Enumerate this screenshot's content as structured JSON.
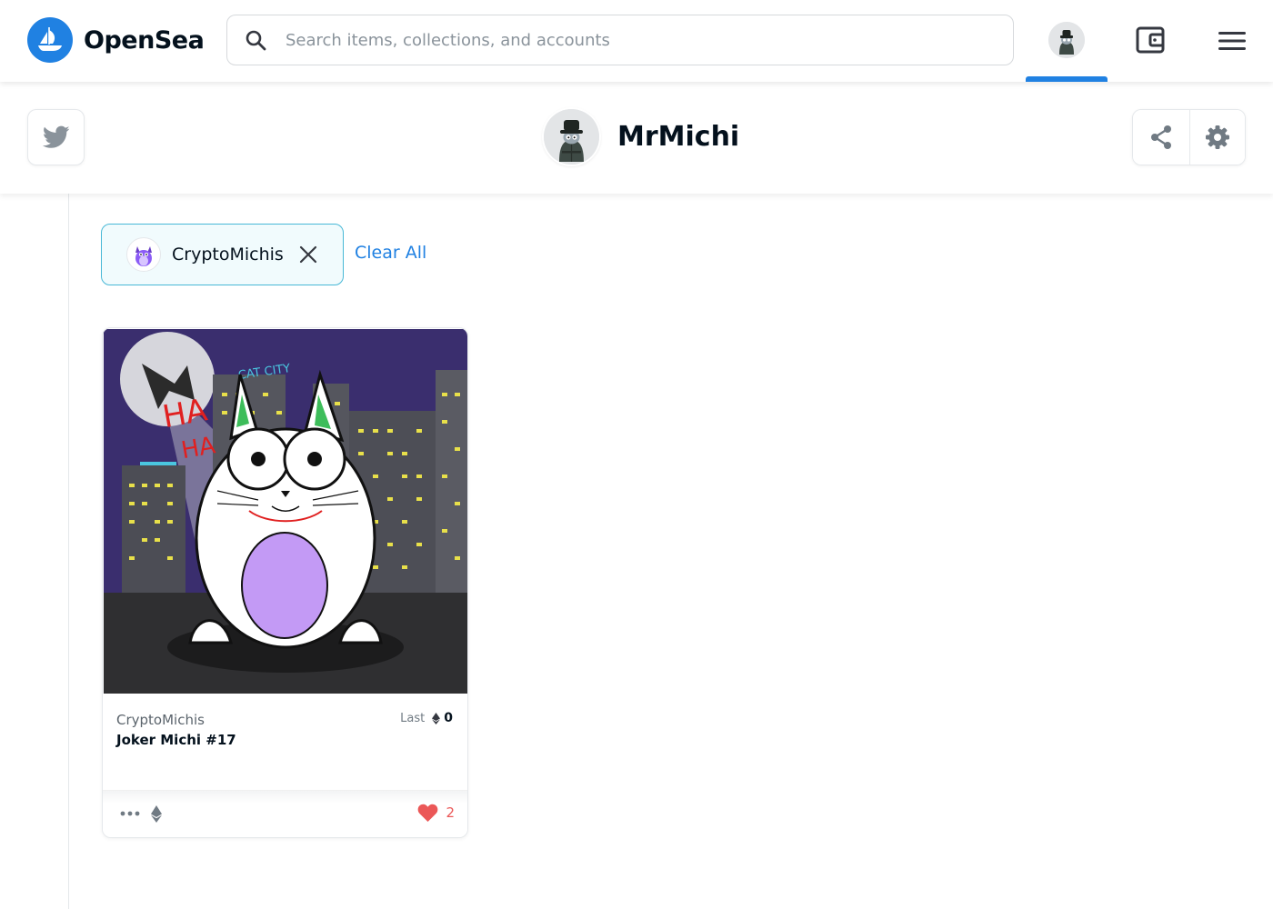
{
  "brand": {
    "name": "OpenSea",
    "accent": "#2081e2"
  },
  "search": {
    "placeholder": "Search items, collections, and accounts",
    "value": ""
  },
  "profile": {
    "name": "MrMichi"
  },
  "filters": {
    "active": [
      {
        "label": "CryptoMichis"
      }
    ],
    "clear_all": "Clear All"
  },
  "cards": [
    {
      "collection": "CryptoMichis",
      "title": "Joker Michi #17",
      "last_label": "Last",
      "last_price": "0",
      "likes": "2",
      "image_text": {
        "sign": "CAT CITY",
        "bubble_1": "HA",
        "bubble_2": "HA"
      }
    }
  ],
  "icons": {
    "logo": "opensea-logo-icon",
    "search": "search-icon",
    "wallet": "wallet-icon",
    "menu": "hamburger-menu-icon",
    "twitter": "twitter-icon",
    "share": "share-icon",
    "settings": "gear-icon",
    "close": "close-icon",
    "more": "more-dots-icon",
    "eth": "ethereum-icon",
    "like": "heart-icon"
  }
}
